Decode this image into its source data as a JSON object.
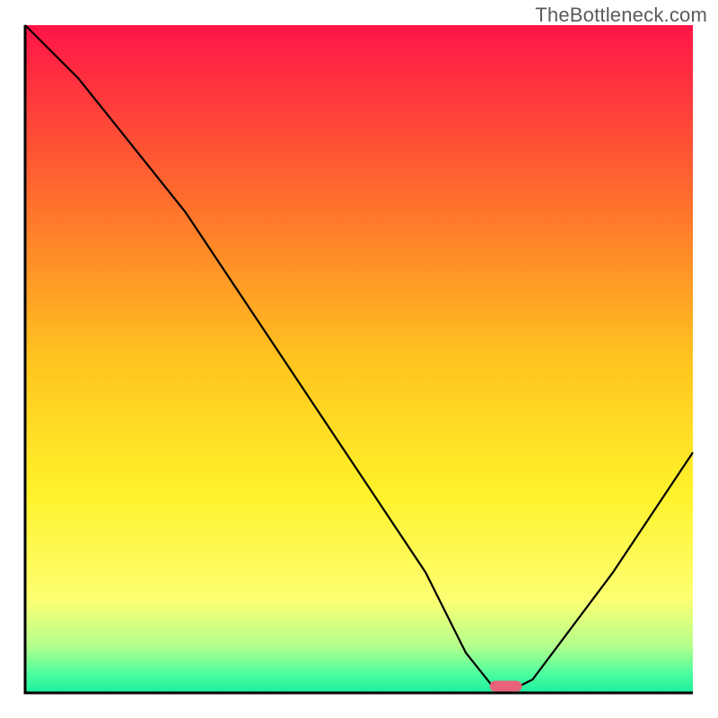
{
  "watermark": "TheBottleneck.com",
  "chart_data": {
    "type": "line",
    "title": "",
    "xlabel": "",
    "ylabel": "",
    "xlim": [
      0,
      100
    ],
    "ylim": [
      0,
      100
    ],
    "background": {
      "type": "vertical_gradient",
      "stops": [
        {
          "pos": 0.0,
          "color": "#ff1447"
        },
        {
          "pos": 0.25,
          "color": "#ff6a2e"
        },
        {
          "pos": 0.5,
          "color": "#ffc41f"
        },
        {
          "pos": 0.7,
          "color": "#fff22a"
        },
        {
          "pos": 0.86,
          "color": "#fdff72"
        },
        {
          "pos": 0.93,
          "color": "#b4ff8c"
        },
        {
          "pos": 0.97,
          "color": "#4fff9e"
        },
        {
          "pos": 1.0,
          "color": "#1cefa0"
        }
      ]
    },
    "series": [
      {
        "name": "bottleneck-curve",
        "color": "#000000",
        "x": [
          0,
          8,
          24,
          48,
          60,
          66,
          70,
          74,
          76,
          88,
          100
        ],
        "values": [
          100,
          92,
          72,
          36,
          18,
          6,
          1,
          1,
          2,
          18,
          36
        ]
      }
    ],
    "marker": {
      "name": "optimal-point",
      "x": 72,
      "y": 1,
      "color": "#e8637a",
      "shape": "rounded-pill"
    },
    "axes": {
      "show_ticks": false,
      "frame_color": "#000000",
      "frame_width": 3
    }
  }
}
